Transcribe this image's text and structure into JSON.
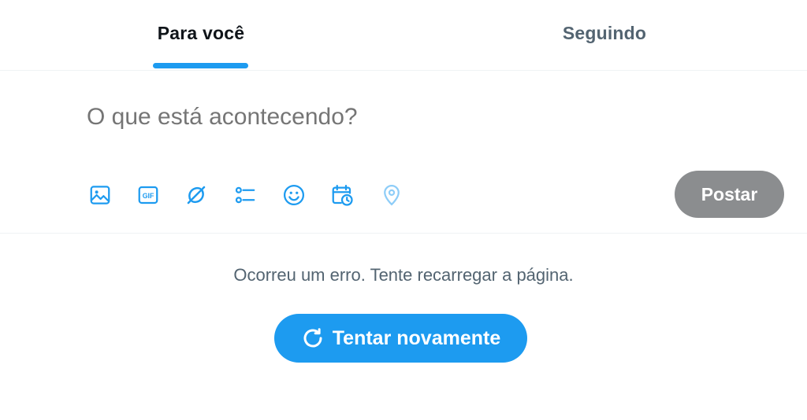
{
  "tabs": [
    {
      "label": "Para você",
      "active": true
    },
    {
      "label": "Seguindo",
      "active": false
    }
  ],
  "composer": {
    "placeholder": "O que está acontecendo?",
    "toolbar_icons": [
      "image-icon",
      "gif-icon",
      "grok-icon",
      "poll-icon",
      "emoji-icon",
      "schedule-icon",
      "location-icon"
    ],
    "post_label": "Postar"
  },
  "error": {
    "message": "Ocorreu um erro. Tente recarregar a página.",
    "retry_label": "Tentar novamente"
  },
  "colors": {
    "accent": "#1d9bf0",
    "post_disabled": "#8b8d8f",
    "secondary_text": "#536471"
  }
}
